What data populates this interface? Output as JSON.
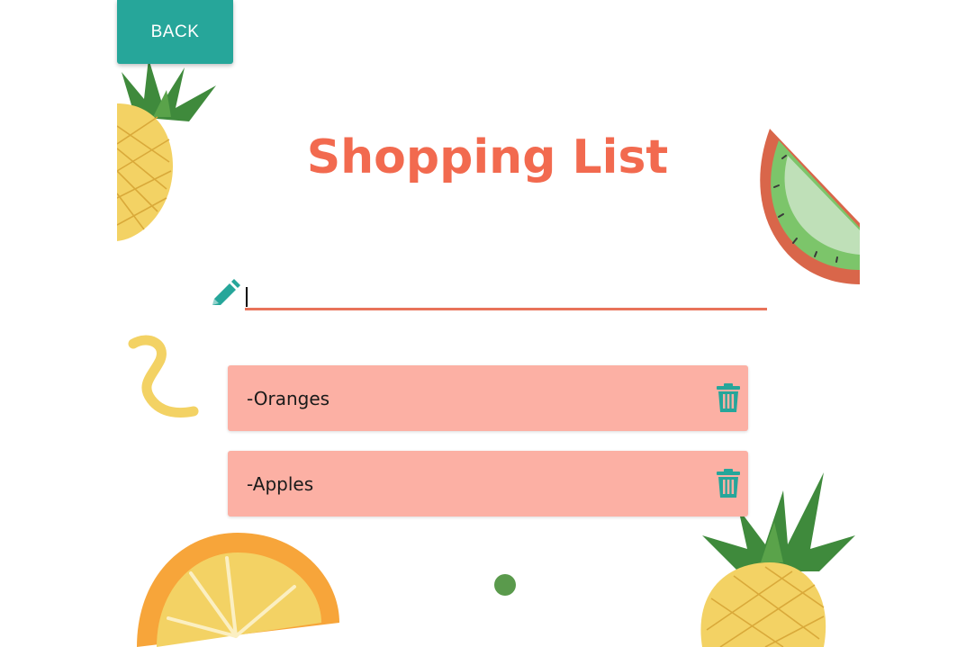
{
  "header": {
    "back_label": "BACK"
  },
  "page": {
    "title": "Shopping List"
  },
  "input": {
    "value": "",
    "placeholder": ""
  },
  "items": [
    {
      "label": "-Oranges"
    },
    {
      "label": "-Apples"
    }
  ],
  "icons": {
    "pencil": "pencil-icon",
    "delete": "trash-icon"
  },
  "colors": {
    "accent": "#26a69a",
    "title": "#f26a4f",
    "item_background": "#fcb0a4",
    "input_underline": "#e8735a"
  }
}
